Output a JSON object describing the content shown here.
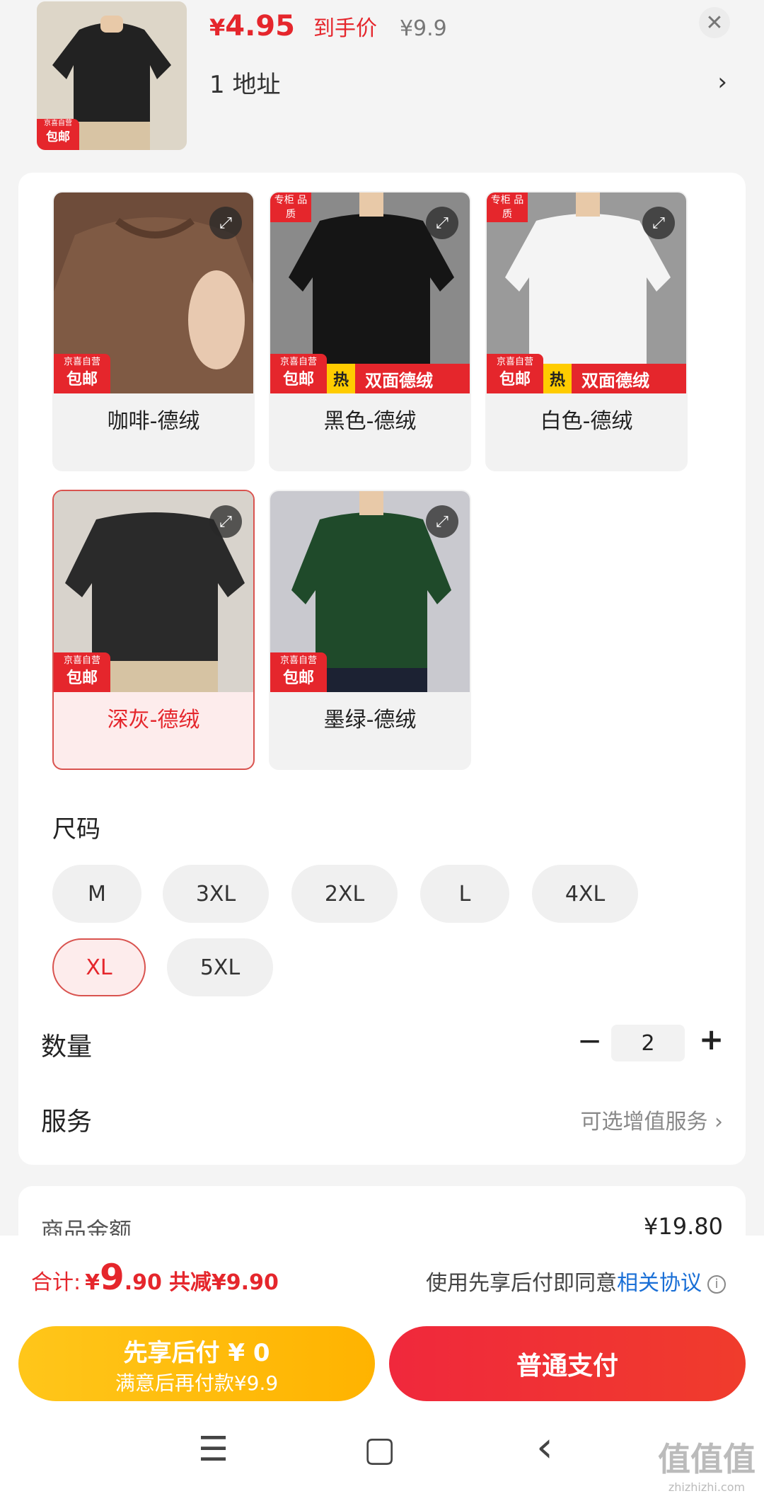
{
  "header": {
    "price_yen": "¥",
    "price_value": "4.95",
    "price_tag": "到手价",
    "original_price": "¥9.9",
    "address_text": "1  地址",
    "address_chevron": "›",
    "close": "✕",
    "thumb_badge_top": "京喜自营",
    "thumb_badge_bottom": "包邮"
  },
  "variants": [
    {
      "label": "咖啡-德绒",
      "badge_top": "京喜自营",
      "badge_bottom": "包邮",
      "color": "#7b5a46",
      "selected": false
    },
    {
      "label": "黑色-德绒",
      "badge_top": "京喜自营",
      "badge_bottom": "包邮",
      "corner_badge": "专柜 品质",
      "promo_hot": "热",
      "promo_text": "双面德绒",
      "color": "#1a1a1a",
      "selected": false
    },
    {
      "label": "白色-德绒",
      "badge_top": "京喜自营",
      "badge_bottom": "包邮",
      "corner_badge": "专柜 品质",
      "promo_hot": "热",
      "promo_text": "双面德绒",
      "color": "#f3f3f3",
      "selected": false
    },
    {
      "label": "深灰-德绒",
      "badge_top": "京喜自营",
      "badge_bottom": "包邮",
      "color": "#2b2b2b",
      "selected": true
    },
    {
      "label": "墨绿-德绒",
      "badge_top": "京喜自营",
      "badge_bottom": "包邮",
      "color": "#1f4a2a",
      "selected": false
    }
  ],
  "size": {
    "title": "尺码",
    "options": [
      "M",
      "3XL",
      "2XL",
      "L",
      "4XL",
      "XL",
      "5XL"
    ],
    "selected": "XL"
  },
  "quantity": {
    "title": "数量",
    "minus": "−",
    "value": "2",
    "plus": "+"
  },
  "service": {
    "title": "服务",
    "value": "可选增值服务  ›"
  },
  "summary": {
    "goods_label": "商品金额",
    "goods_value": "¥19.80"
  },
  "footer": {
    "total_label": "合计:",
    "total_yen": "¥",
    "total_int": "9",
    "total_dec": ".90",
    "total_saved": "共减¥9.90",
    "agree_text": "使用先享后付即同意",
    "agree_link": "相关协议",
    "info_icon": "i",
    "pay_later_line1": "先享后付 ¥ 0",
    "pay_later_line2": "满意后再付款¥9.9",
    "pay_normal": "普通支付"
  },
  "nav": {
    "menu": "☰",
    "home": "▢",
    "back": "‹"
  },
  "watermark": {
    "main": "值值值",
    "sub": "zhizhizhi.com"
  },
  "colors": {
    "accent": "#e5262c",
    "link": "#1a6fd6",
    "pay_later": "#ffbd0a"
  }
}
